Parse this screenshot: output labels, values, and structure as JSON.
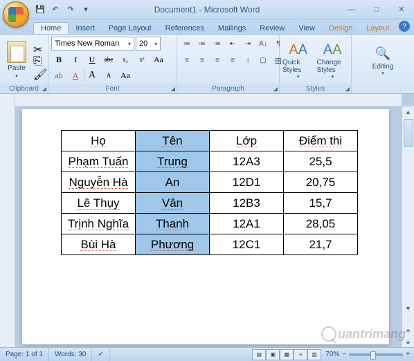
{
  "title": "Document1 - Microsoft Word",
  "qat": {
    "save": "💾",
    "undo": "↶",
    "redo": "↷"
  },
  "tabs": [
    "Home",
    "Insert",
    "Page Layout",
    "References",
    "Mailings",
    "Review",
    "View",
    "Design",
    "Layout"
  ],
  "active_tab": 0,
  "ribbon": {
    "clipboard": {
      "label": "Clipboard",
      "paste": "Paste"
    },
    "font": {
      "label": "Font",
      "name": "Times New Roman",
      "size": "20",
      "bold": "B",
      "italic": "I",
      "underline": "U",
      "strike": "abc",
      "sub": "x₂",
      "sup": "x²",
      "case": "Aa",
      "grow": "A",
      "shrink": "A",
      "clear": "⌫",
      "highlight": "ab",
      "color": "A"
    },
    "paragraph": {
      "label": "Paragraph",
      "bullets": "•≡",
      "numbers": "1≡",
      "multilevel": "≡",
      "indent_dec": "⇤",
      "indent_inc": "⇥",
      "align_l": "≡",
      "align_c": "≡",
      "align_r": "≡",
      "justify": "≡",
      "spacing": "↕≡",
      "shading": "▢",
      "borders": "田",
      "sort": "A↓Z",
      "show": "¶"
    },
    "styles": {
      "label": "Styles",
      "quick": "Quick Styles",
      "change": "Change Styles"
    },
    "editing": {
      "label": "Editing",
      "find": "Editing"
    }
  },
  "table": {
    "headers": [
      "Họ",
      "Tên",
      "Lớp",
      "Điểm thi"
    ],
    "rows": [
      [
        "Phạm Tuấn",
        "Trung",
        "12A3",
        "25,5"
      ],
      [
        "Nguyễn Hà",
        "An",
        "12D1",
        "20,75"
      ],
      [
        "Lê Thụy",
        "Vân",
        "12B3",
        "15,7"
      ],
      [
        "Trịnh Nghĩa",
        "Thanh",
        "12A1",
        "28,05"
      ],
      [
        "Bùi Hà",
        "Phương",
        "12C1",
        "21,7"
      ]
    ],
    "selected_column": 1
  },
  "status": {
    "page": "Page: 1 of 1",
    "words": "Words: 30",
    "zoom": "70%"
  },
  "watermark": "uantrimang"
}
